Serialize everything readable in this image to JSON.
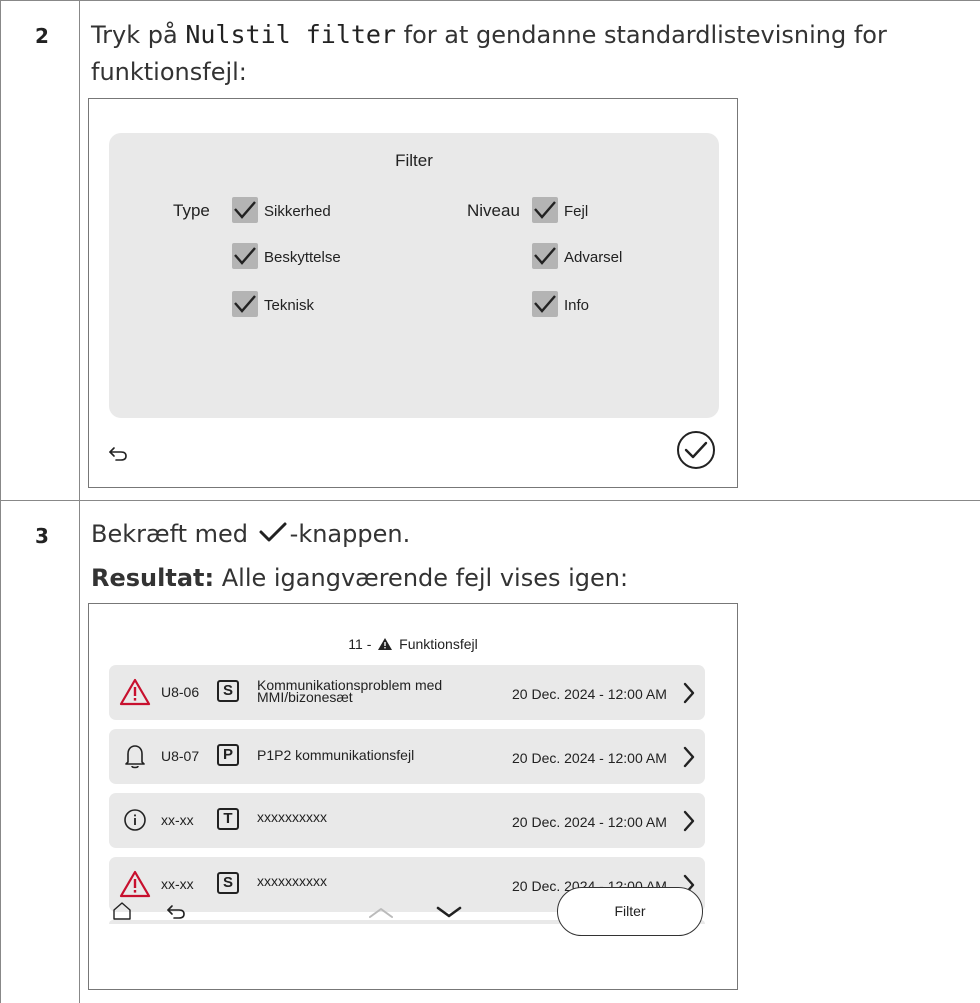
{
  "step2": {
    "number": "2",
    "text_before": "Tryk på",
    "code": "Nulstil filter",
    "text_after": "for at gendanne standardlistevisning for",
    "text_line2": "funktionsfejl:"
  },
  "filter_screen": {
    "title": "Filter",
    "type_label": "Type",
    "type_options": [
      {
        "label": "Sikkerhed",
        "checked": true
      },
      {
        "label": "Beskyttelse",
        "checked": true
      },
      {
        "label": "Teknisk",
        "checked": true
      }
    ],
    "level_label": "Niveau",
    "level_options": [
      {
        "label": "Fejl",
        "checked": true
      },
      {
        "label": "Advarsel",
        "checked": true
      },
      {
        "label": "Info",
        "checked": true
      }
    ],
    "back_icon": "back-arrow-icon",
    "confirm_icon": "check-circle-icon"
  },
  "step3": {
    "number": "3",
    "text_before": "Bekræft med",
    "text_after": "-knappen.",
    "result_label": "Resultat:",
    "result_text": "Alle igangværende fejl vises igen:"
  },
  "fault_screen": {
    "title_count": "11 -",
    "title_text": "Funktionsfejl",
    "rows": [
      {
        "icon": "warning-triangle-icon",
        "code": "U8-06",
        "badge": "S",
        "desc_line1": "Kommunikationsproblem med",
        "desc_line2": "MMI/bizonesæt",
        "date": "20 Dec. 2024 - 12:00 AM"
      },
      {
        "icon": "bell-icon",
        "code": "U8-07",
        "badge": "P",
        "desc_line1": "P1P2 kommunikationsfejl",
        "desc_line2": "",
        "date": "20 Dec. 2024 - 12:00 AM"
      },
      {
        "icon": "info-circle-icon",
        "code": "xx-xx",
        "badge": "T",
        "desc_line1": "xxxxxxxxxx",
        "desc_line2": "",
        "date": "20 Dec. 2024 - 12:00 AM"
      },
      {
        "icon": "warning-triangle-icon",
        "code": "xx-xx",
        "badge": "S",
        "desc_line1": "xxxxxxxxxx",
        "desc_line2": "",
        "date": "20 Dec. 2024 - 12:00 AM"
      }
    ],
    "filter_button": "Filter"
  },
  "colors": {
    "warning": "#c8102e",
    "panel": "#e9e9e9",
    "checkbox": "#b4b4b4"
  }
}
